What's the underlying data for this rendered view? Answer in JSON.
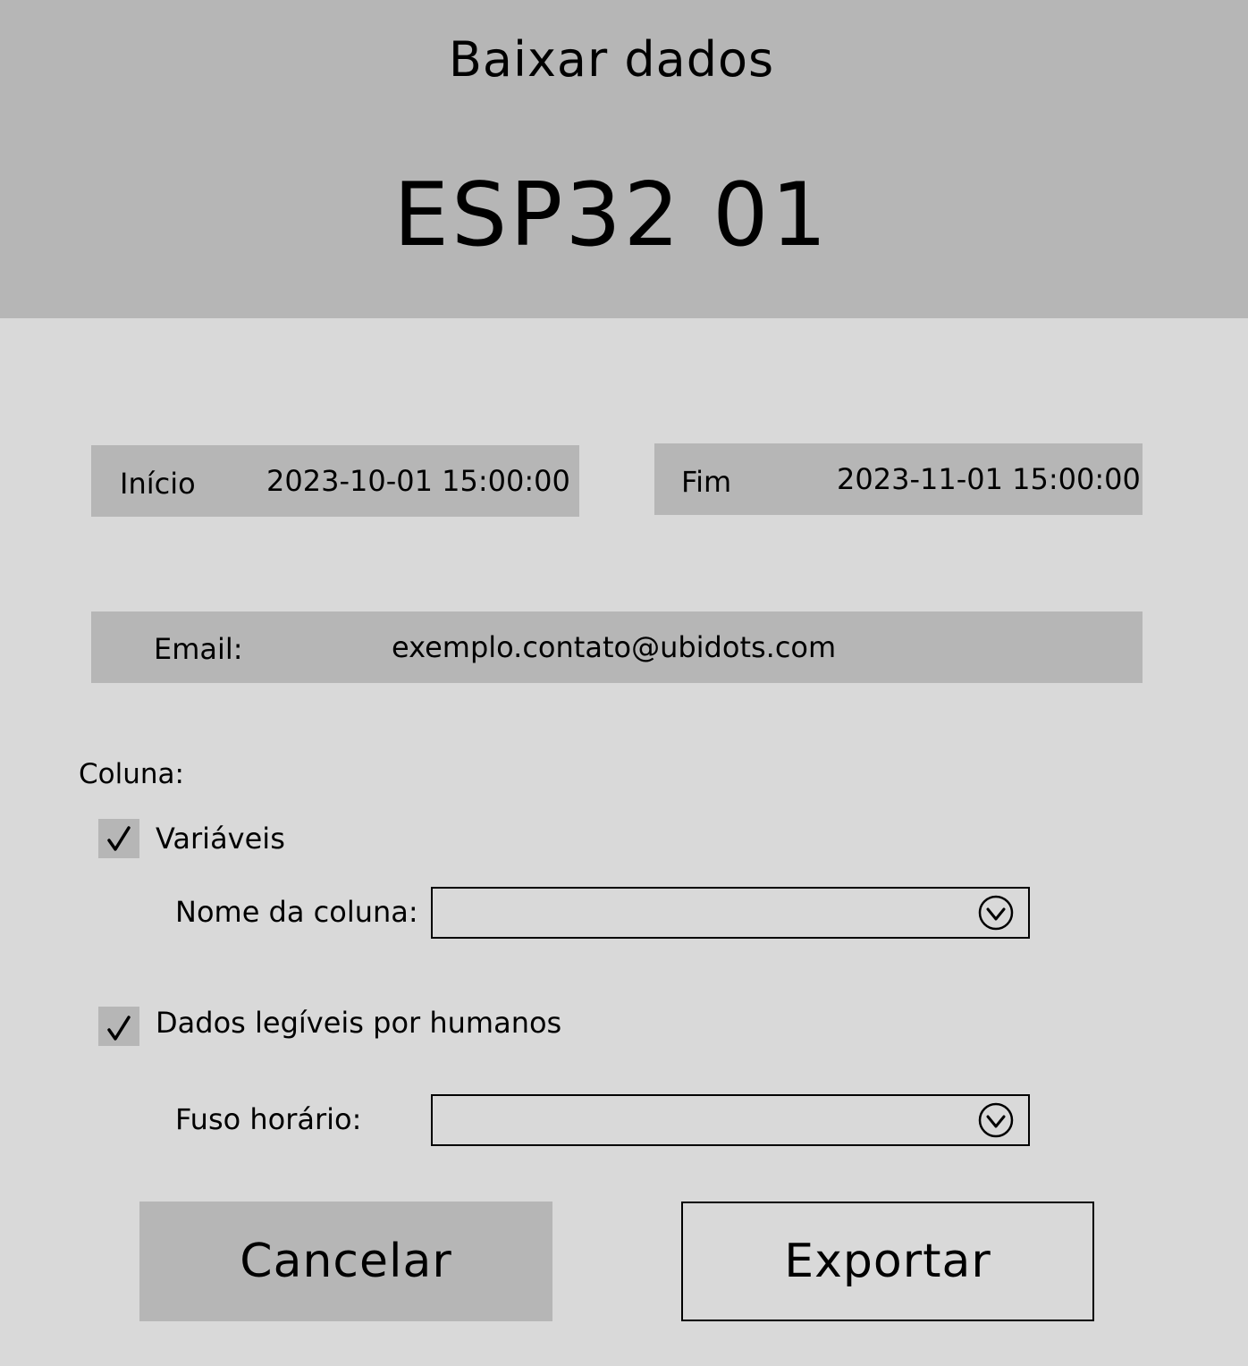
{
  "header": {
    "title": "Baixar dados",
    "device_name": "ESP32 01"
  },
  "date_range": {
    "start_label": "Início",
    "start_value": "2023-10-01 15:00:00",
    "end_label": "Fim",
    "end_value": "2023-11-01 15:00:00"
  },
  "email": {
    "label": "Email:",
    "value": "exemplo.contato@ubidots.com"
  },
  "columns": {
    "section_label": "Coluna:",
    "variables": {
      "label": "Variáveis",
      "checked": true,
      "column_name_label": "Nome da coluna:",
      "column_name_value": ""
    },
    "human_readable": {
      "label": "Dados legíveis por humanos",
      "checked": true,
      "timezone_label": "Fuso horário:",
      "timezone_value": ""
    }
  },
  "actions": {
    "cancel_label": "Cancelar",
    "export_label": "Exportar"
  },
  "icons": {
    "checkbox_mark": "check-icon",
    "select_chevron": "chevron-down-circle-icon"
  },
  "colors": {
    "header_bg": "#b6b6b6",
    "page_bg": "#d9d9d9",
    "field_bg": "#b6b6b6"
  }
}
